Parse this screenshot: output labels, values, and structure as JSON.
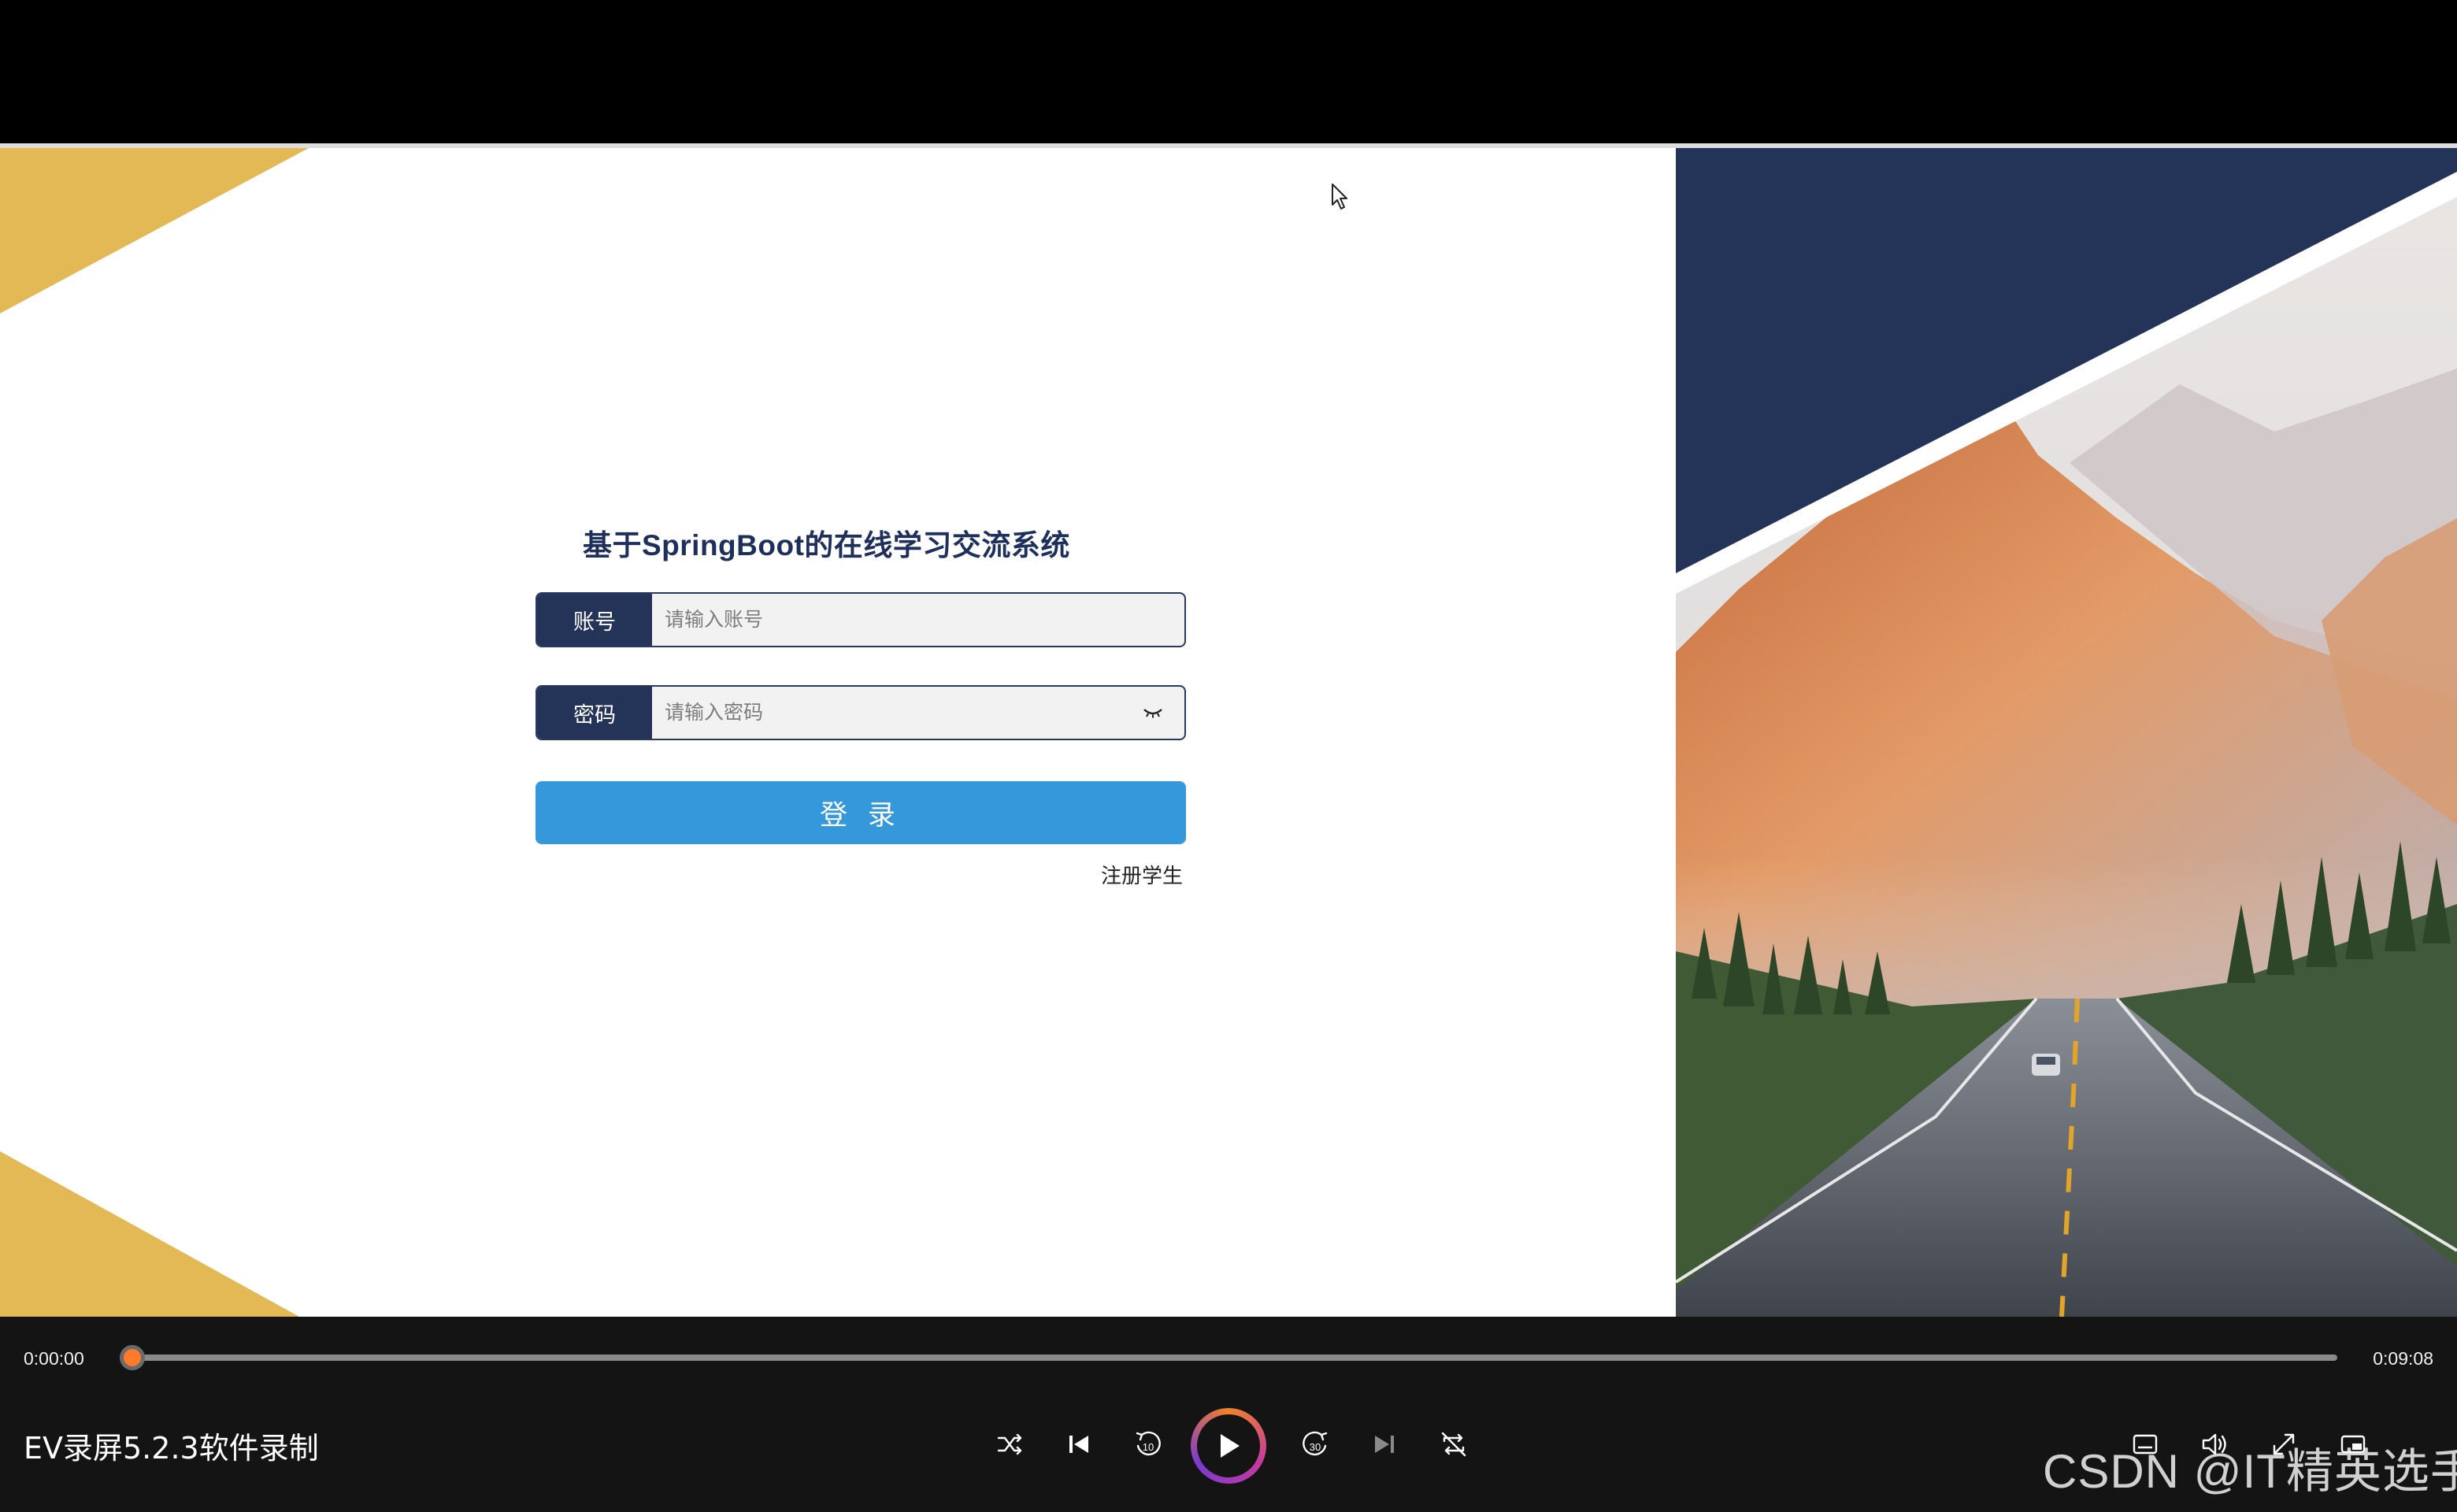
{
  "login": {
    "title": "基于SpringBoot的在线学习交流系统",
    "account_label": "账号",
    "account_placeholder": "请输入账号",
    "account_value": "",
    "password_label": "密码",
    "password_placeholder": "请输入密码",
    "password_value": "",
    "login_button": "登 录",
    "register_link": "注册学生"
  },
  "player": {
    "current_time": "0:00:00",
    "total_time": "0:09:08",
    "progress_fraction": 0.0,
    "recorder_title": "EV录屏5.2.3软件录制",
    "controls": [
      "shuffle-icon",
      "previous-icon",
      "rewind-10-icon",
      "play-icon",
      "forward-30-icon",
      "next-icon",
      "repeat-off-icon",
      "subtitles-icon",
      "volume-icon",
      "fullscreen-icon",
      "mini-player-icon"
    ]
  },
  "watermark": "CSDN @IT精英选手",
  "colors": {
    "gold": "#e2b955",
    "navy": "#243358",
    "login_blue": "#3498db",
    "progress_orange": "#ff7a2a"
  }
}
